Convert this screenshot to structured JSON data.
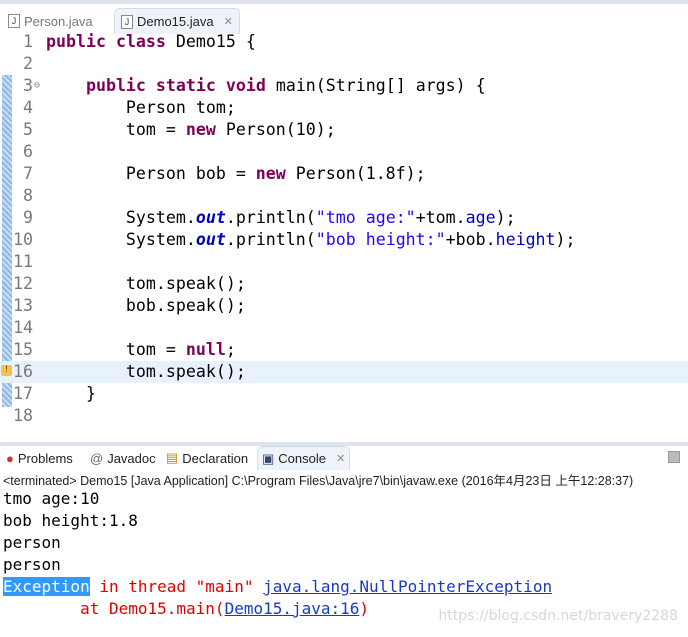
{
  "editor_tabs": [
    {
      "label": "Person.java",
      "active": false
    },
    {
      "label": "Demo15.java",
      "active": true
    }
  ],
  "code_lines": [
    {
      "n": "1",
      "tokens": [
        [
          "public",
          "kw"
        ],
        [
          " ",
          ""
        ],
        [
          "class",
          "kw"
        ],
        [
          " Demo15 {",
          ""
        ]
      ]
    },
    {
      "n": "2",
      "tokens": []
    },
    {
      "n": "3",
      "fold": true,
      "tokens": [
        [
          "    ",
          ""
        ],
        [
          "public",
          "kw"
        ],
        [
          " ",
          ""
        ],
        [
          "static",
          "kw"
        ],
        [
          " ",
          ""
        ],
        [
          "void",
          "kw"
        ],
        [
          " main(String[] args) {",
          ""
        ]
      ]
    },
    {
      "n": "4",
      "tokens": [
        [
          "        Person tom;",
          ""
        ]
      ]
    },
    {
      "n": "5",
      "tokens": [
        [
          "        tom = ",
          ""
        ],
        [
          "new",
          "kw"
        ],
        [
          " Person(10);",
          ""
        ]
      ]
    },
    {
      "n": "6",
      "tokens": []
    },
    {
      "n": "7",
      "tokens": [
        [
          "        Person bob = ",
          ""
        ],
        [
          "new",
          "kw"
        ],
        [
          " Person(1.8f);",
          ""
        ]
      ]
    },
    {
      "n": "8",
      "tokens": []
    },
    {
      "n": "9",
      "tokens": [
        [
          "        System.",
          ""
        ],
        [
          "out",
          "sfld"
        ],
        [
          ".println(",
          ""
        ],
        [
          "\"tmo age:\"",
          "str"
        ],
        [
          "+tom.",
          ""
        ],
        [
          "age",
          "fld"
        ],
        [
          ");",
          ""
        ]
      ]
    },
    {
      "n": "10",
      "tokens": [
        [
          "        System.",
          ""
        ],
        [
          "out",
          "sfld"
        ],
        [
          ".println(",
          ""
        ],
        [
          "\"bob height:\"",
          "str"
        ],
        [
          "+bob.",
          ""
        ],
        [
          "height",
          "fld"
        ],
        [
          ");",
          ""
        ]
      ]
    },
    {
      "n": "11",
      "tokens": []
    },
    {
      "n": "12",
      "tokens": [
        [
          "        tom.speak();",
          ""
        ]
      ]
    },
    {
      "n": "13",
      "tokens": [
        [
          "        bob.speak();",
          ""
        ]
      ]
    },
    {
      "n": "14",
      "tokens": []
    },
    {
      "n": "15",
      "tokens": [
        [
          "        tom = ",
          ""
        ],
        [
          "null",
          "kw"
        ],
        [
          ";",
          ""
        ]
      ]
    },
    {
      "n": "16",
      "current": true,
      "warning": true,
      "tokens": [
        [
          "        tom.speak();",
          ""
        ]
      ]
    },
    {
      "n": "17",
      "tokens": [
        [
          "    }",
          ""
        ]
      ]
    },
    {
      "n": "18",
      "tokens": []
    }
  ],
  "view_tabs": [
    {
      "label": "Problems",
      "icon": "problems-icon"
    },
    {
      "label": "Javadoc",
      "icon": "at-icon"
    },
    {
      "label": "Declaration",
      "icon": "declaration-icon"
    },
    {
      "label": "Console",
      "icon": "console-icon",
      "active": true
    }
  ],
  "console": {
    "status": "<terminated> Demo15 [Java Application] C:\\Program Files\\Java\\jre7\\bin\\javaw.exe (2016年4月23日 上午12:28:37)",
    "output": [
      "tmo age:10",
      "bob height:1.8",
      "person",
      "person"
    ],
    "exception": {
      "word": "Exception",
      "mid": " in thread \"main\" ",
      "type": "java.lang.NullPointerException",
      "at": "        at Demo15.main(",
      "loc": "Demo15.java:16",
      "end": ")"
    }
  },
  "watermark": "https://blog.csdn.net/bravery2288",
  "colors": {
    "keyword": "#7f0055",
    "string": "#2a00ff",
    "field": "#0000c0",
    "error": "#e00000",
    "link": "#1a39c4",
    "selection": "#3399ff"
  }
}
